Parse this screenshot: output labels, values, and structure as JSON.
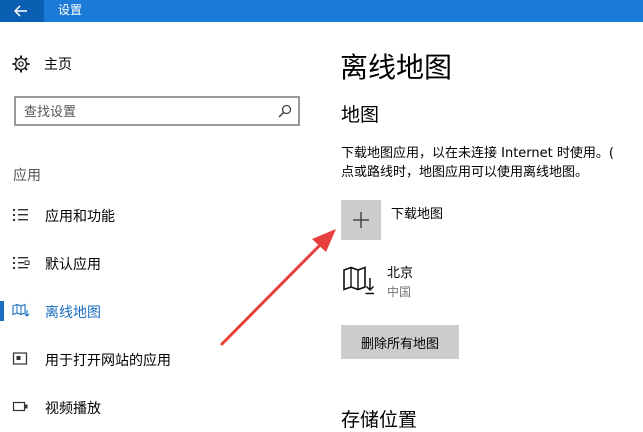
{
  "window": {
    "title": "设置"
  },
  "sidebar": {
    "home_label": "主页",
    "search_placeholder": "查找设置",
    "section_header": "应用",
    "items": [
      {
        "label": "应用和功能",
        "icon": "list-icon"
      },
      {
        "label": "默认应用",
        "icon": "default-apps-icon"
      },
      {
        "label": "离线地图",
        "icon": "offline-map-icon",
        "active": true
      },
      {
        "label": "用于打开网站的应用",
        "icon": "open-website-icon"
      },
      {
        "label": "视频播放",
        "icon": "video-icon"
      }
    ]
  },
  "main": {
    "page_title": "离线地图",
    "maps_section_title": "地图",
    "description_line1": "下载地图应用，以在未连接 Internet 时使用。(",
    "description_line2": "点或路线时，地图应用可以使用离线地图。",
    "download_label": "下载地图",
    "downloaded_map": {
      "name": "北京",
      "country": "中国"
    },
    "delete_all_label": "删除所有地图",
    "storage_section_title": "存储位置"
  },
  "colors": {
    "titlebar": "#1b7bd6",
    "back_button": "#0b5fb3",
    "accent": "#1b6ec2",
    "button_gray": "#cccccc",
    "annotation_arrow": "#e8403c"
  }
}
